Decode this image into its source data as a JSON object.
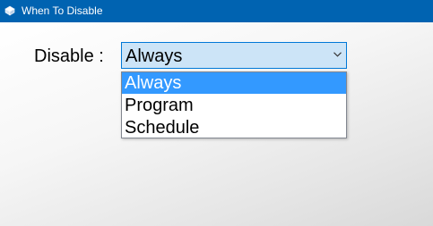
{
  "window": {
    "title": "When To Disable",
    "icon": "app-icon",
    "titlebar_color": "#0063b1"
  },
  "form": {
    "label": "Disable :",
    "combo": {
      "selected_value": "Always",
      "arrow_icon": "chevron-down-icon",
      "options": [
        "Always",
        "Program",
        "Schedule"
      ],
      "highlighted_option": "Always"
    }
  },
  "colors": {
    "highlight": "#3399ff",
    "combo_focus_border": "#0078d7",
    "combo_background": "#cce4f7"
  }
}
